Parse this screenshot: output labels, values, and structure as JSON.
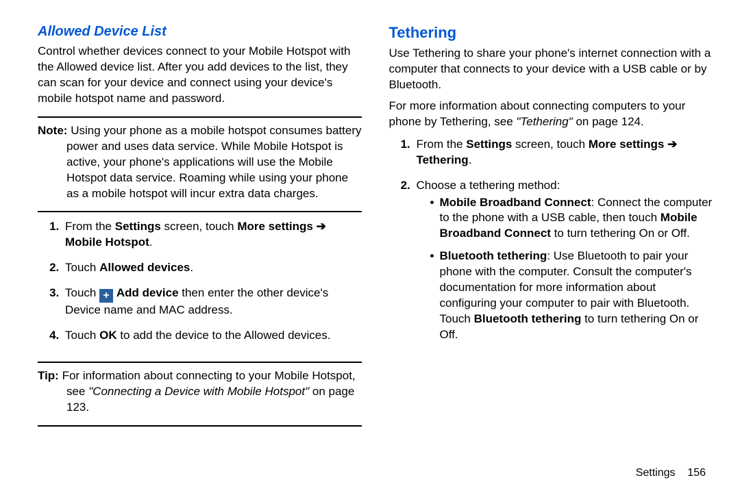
{
  "left": {
    "title": "Allowed Device List",
    "intro": "Control whether devices connect to your Mobile Hotspot with the Allowed device list. After you add devices to the list, they can scan for your device and connect using your device's mobile hotspot name and password.",
    "noteLabel": "Note:",
    "noteBody": "Using your phone as a mobile hotspot consumes battery power and uses data service. While Mobile Hotspot is active, your phone's applications will use the Mobile Hotspot data service. Roaming while using your phone as a mobile hotspot will incur extra data charges.",
    "step1_a": "From the ",
    "step1_b": "Settings",
    "step1_c": " screen, touch ",
    "step1_d": "More settings",
    "step1_e": "Mobile Hotspot",
    "step1_arrow": "➔",
    "step1_period": ".",
    "step2_a": "Touch ",
    "step2_b": "Allowed devices",
    "step2_c": ".",
    "step3_a": "Touch ",
    "step3_b": "Add device",
    "step3_c": " then enter the other device's Device name and MAC address.",
    "step4_a": "Touch ",
    "step4_b": "OK",
    "step4_c": " to add the device to the Allowed devices.",
    "tipLabel": "Tip:",
    "tip_a": "For information about connecting to your Mobile Hotspot, see ",
    "tip_b": "\"Connecting a Device with Mobile Hotspot\"",
    "tip_c": " on page 123."
  },
  "right": {
    "heading": "Tethering",
    "intro": "Use Tethering to share your phone's internet connection with a computer that connects to your device with a USB cable or by Bluetooth.",
    "more_a": "For more information about connecting computers to your phone by Tethering, see ",
    "more_b": "\"Tethering\"",
    "more_c": " on page 124.",
    "step1_a": "From the ",
    "step1_b": "Settings",
    "step1_c": " screen, touch ",
    "step1_d": "More settings",
    "step1_e": "Tethering",
    "step1_arrow": "➔",
    "step1_period": ".",
    "step2": "Choose a tethering method:",
    "b1_a": "Mobile Broadband Connect",
    "b1_b": ": Connect the computer to the phone with a USB cable, then touch ",
    "b1_c": "Mobile Broadband Connect",
    "b1_d": " to turn tethering On or Off.",
    "b2_a": "Bluetooth tethering",
    "b2_b": ": Use Bluetooth to pair your phone with the computer. Consult the computer's documentation for more information about configuring your computer to pair with Bluetooth. Touch ",
    "b2_c": "Bluetooth tethering",
    "b2_d": " to turn tethering On or Off."
  },
  "footer": {
    "label": "Settings",
    "page": "156"
  },
  "icons": {
    "plus": "+"
  }
}
